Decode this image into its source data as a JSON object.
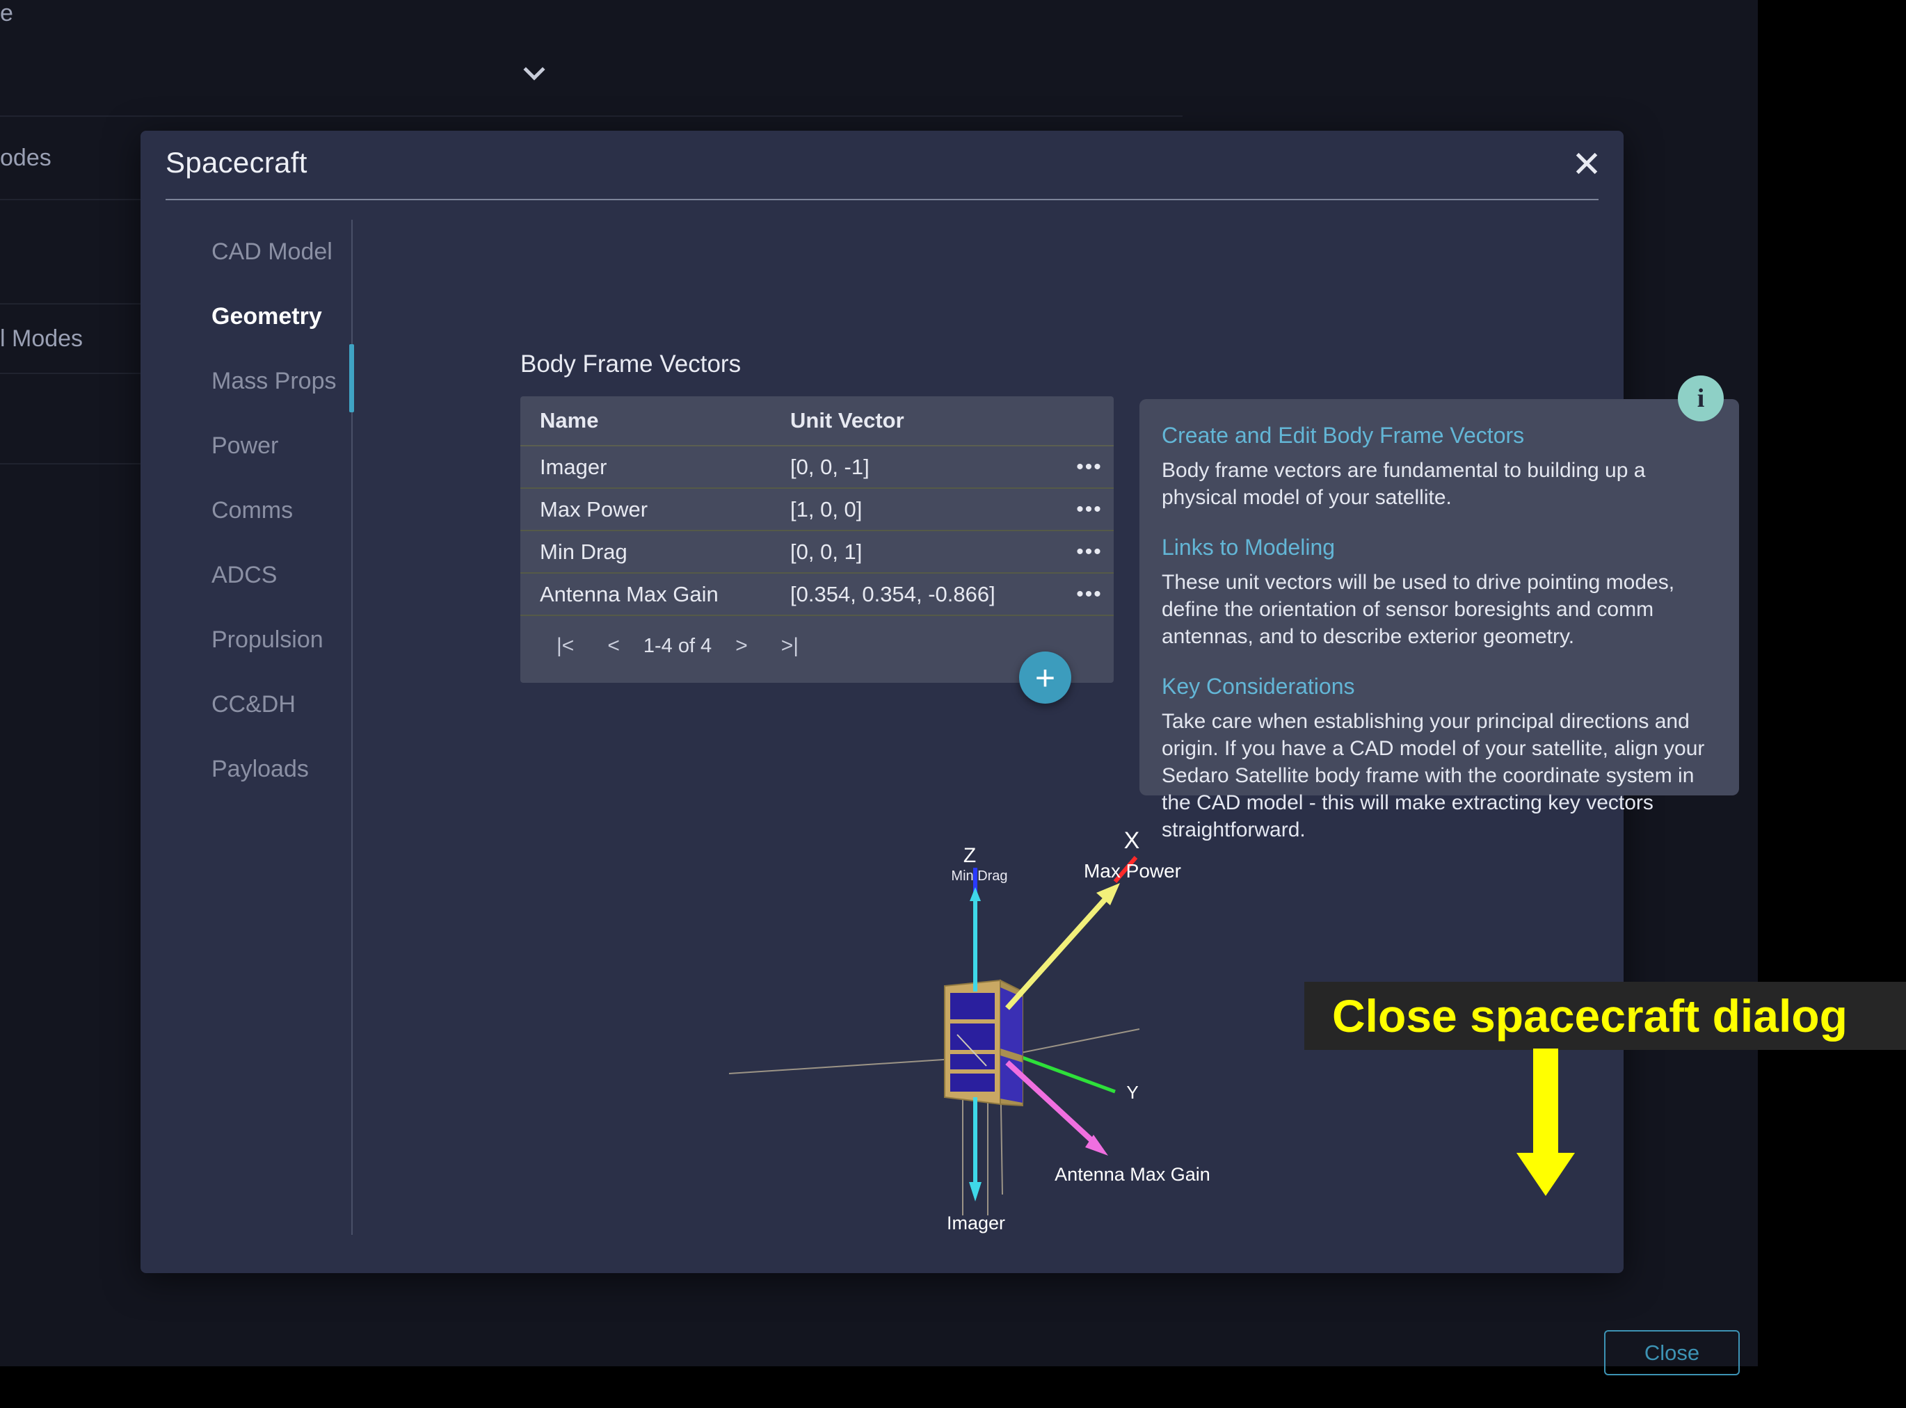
{
  "background": {
    "rows": [
      {
        "label": "e",
        "chevron": false
      },
      {
        "label": "",
        "chevron": true
      },
      {
        "label": "odes",
        "chevron": true
      },
      {
        "label": "",
        "chevron": false
      },
      {
        "label": "l Modes",
        "chevron": false
      },
      {
        "label": "",
        "chevron": false
      }
    ]
  },
  "dialog": {
    "title": "Spacecraft",
    "close_icon": "close-icon",
    "sidebar": {
      "items": [
        {
          "label": "CAD Model",
          "active": false
        },
        {
          "label": "Geometry",
          "active": true
        },
        {
          "label": "Mass Props",
          "active": false
        },
        {
          "label": "Power",
          "active": false
        },
        {
          "label": "Comms",
          "active": false
        },
        {
          "label": "ADCS",
          "active": false
        },
        {
          "label": "Propulsion",
          "active": false
        },
        {
          "label": "CC&DH",
          "active": false
        },
        {
          "label": "Payloads",
          "active": false
        }
      ]
    },
    "section_title": "Body Frame Vectors",
    "table": {
      "columns": [
        "Name",
        "Unit Vector"
      ],
      "rows": [
        {
          "name": "Imager",
          "vector": "[0, 0, -1]"
        },
        {
          "name": "Max Power",
          "vector": "[1, 0, 0]"
        },
        {
          "name": "Min Drag",
          "vector": "[0, 0, 1]"
        },
        {
          "name": "Antenna Max Gain",
          "vector": "[0.354, 0.354, -0.866]"
        }
      ],
      "row_menu_icon": "overflow-menu-icon",
      "pagination": {
        "first_label": "|<",
        "prev_label": "<",
        "range_label": "1-4 of 4",
        "next_label": ">",
        "last_label": ">|"
      }
    },
    "add_button_label": "+",
    "info_panel": {
      "badge_label": "i",
      "sections": [
        {
          "heading": "Create and Edit Body Frame Vectors",
          "body": "Body frame vectors are fundamental to building up a physical model of your satellite."
        },
        {
          "heading": "Links to Modeling",
          "body": "These unit vectors will be used to drive pointing modes, define the orientation of sensor boresights and comm antennas, and to describe exterior geometry."
        },
        {
          "heading": "Key Considerations",
          "body": "Take care when establishing your principal directions and origin. If you have a CAD model of your satellite, align your Sedaro Satellite body frame with the coordinate system in the CAD model - this will make extracting key vectors straightforward."
        }
      ]
    },
    "viewport": {
      "axis_labels": {
        "x": "X",
        "y": "Y",
        "z": "Z"
      },
      "vector_labels": {
        "min_drag": "Min Drag",
        "max_power": "Max Power",
        "antenna_max_gain": "Antenna Max Gain",
        "imager": "Imager"
      },
      "colors": {
        "min_drag": "#3fd8e8",
        "max_power": "#f2f07a",
        "antenna_max_gain": "#f06fe0",
        "imager": "#3fd8e8",
        "x_axis": "#ff2a2a",
        "y_axis": "#2ee03a",
        "z_axis": "#2a3aff",
        "grid": "#9c9486",
        "body": "#c9a863",
        "panels": "#2a1f9e"
      }
    }
  },
  "annotation": {
    "banner_text": "Close spacecraft dialog",
    "arrow_color": "#ffff00",
    "banner_bg": "#262626",
    "close_button_label": "Close"
  }
}
